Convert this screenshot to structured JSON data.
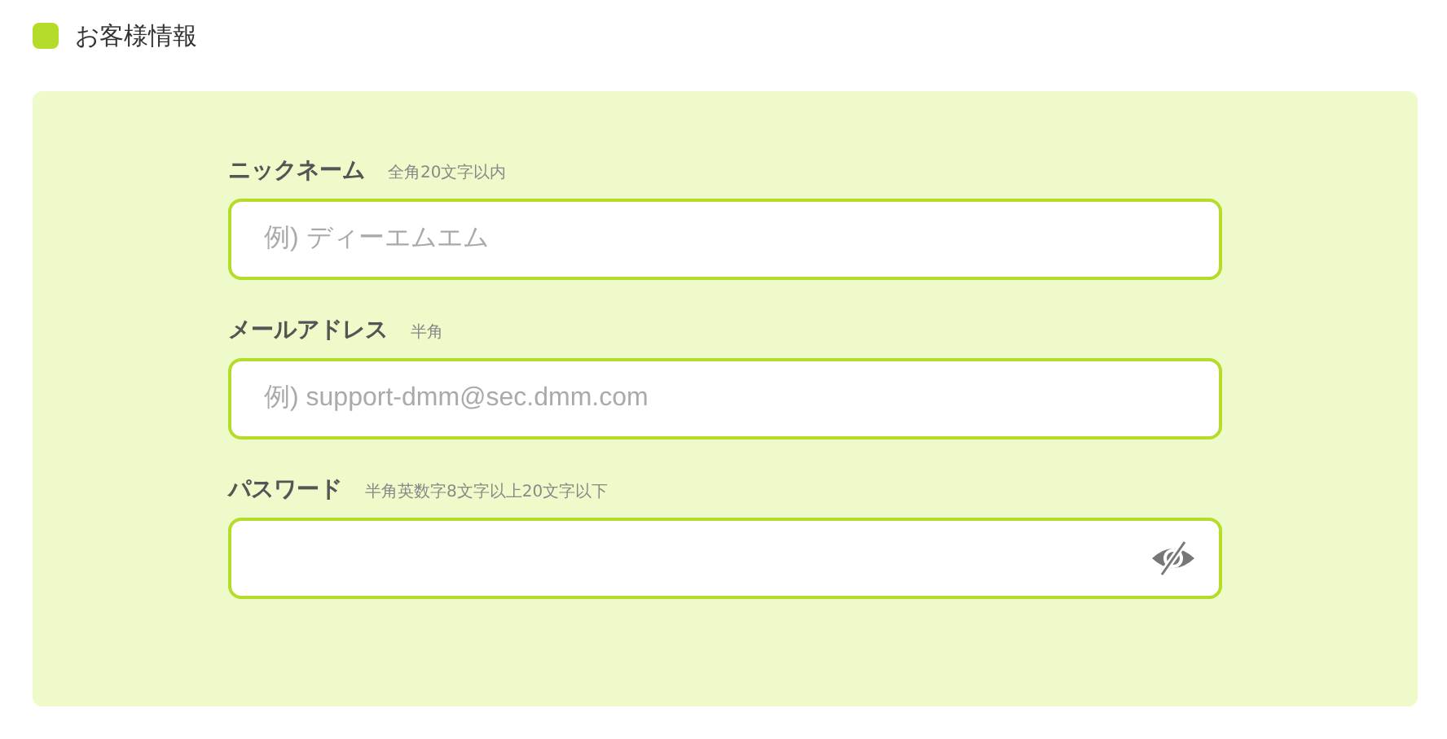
{
  "section": {
    "title": "お客様情報"
  },
  "fields": [
    {
      "kind": "text",
      "label": "ニックネーム",
      "note": "全角20文字以内",
      "placeholder": "例) ディーエムエム"
    },
    {
      "kind": "text",
      "label": "メールアドレス",
      "note": "半角",
      "placeholder": "例) support-dmm@sec.dmm.com"
    },
    {
      "kind": "password",
      "label": "パスワード",
      "note": "半角英数字8文字以上20文字以下"
    }
  ]
}
